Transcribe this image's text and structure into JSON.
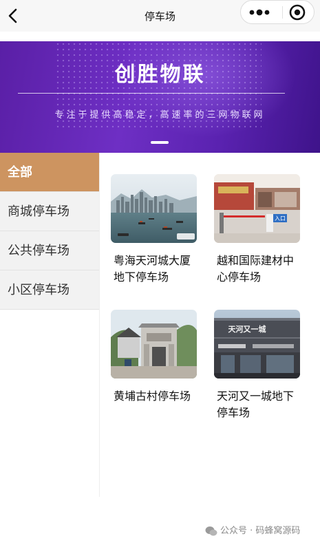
{
  "nav": {
    "title": "停车场"
  },
  "banner": {
    "title": "创胜物联",
    "subtitle": "专注于提供高稳定，高速率的三网物联网"
  },
  "categories": [
    {
      "label": "全部",
      "active": true
    },
    {
      "label": "商城停车场",
      "active": false
    },
    {
      "label": "公共停车场",
      "active": false
    },
    {
      "label": "小区停车场",
      "active": false
    }
  ],
  "parking_lots": [
    {
      "name": "粤海天河城大厦地下停车场"
    },
    {
      "name": "越和国际建材中心停车场"
    },
    {
      "name": "黄埔古村停车场"
    },
    {
      "name": "天河又一城地下停车场"
    }
  ],
  "photo_texts": {
    "mall_entrance_sign": "入口",
    "mall_building_sign": "天河又一城"
  },
  "footer": {
    "text": "公众号 · 码蜂窝源码"
  }
}
